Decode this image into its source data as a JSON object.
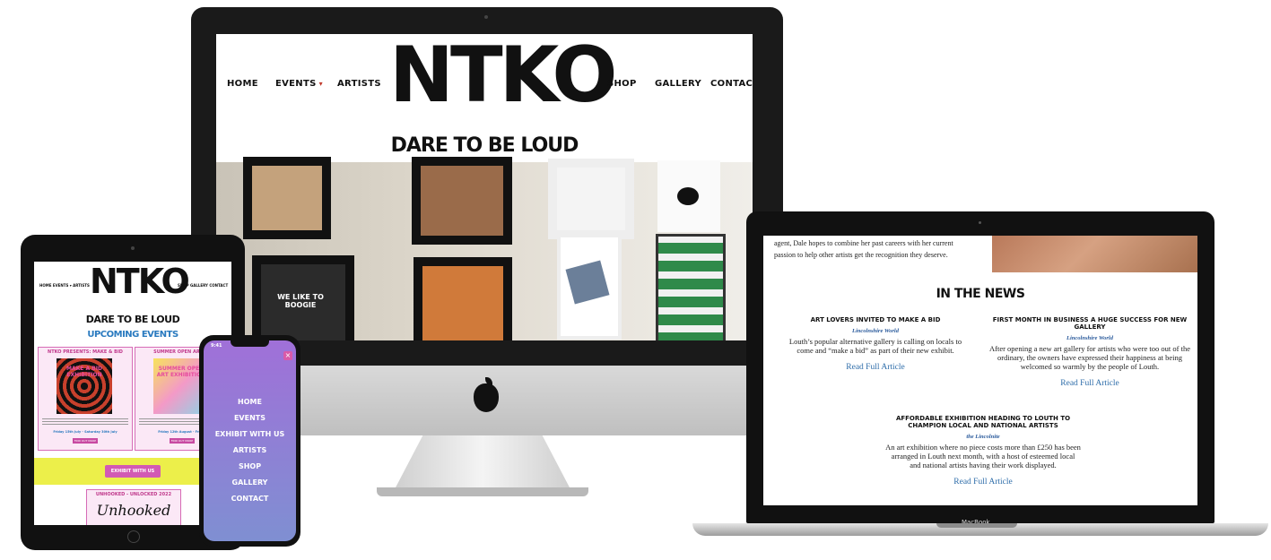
{
  "desktop": {
    "nav_left": [
      "HOME",
      "EVENTS",
      "ARTISTS"
    ],
    "dropdown_marker": "▾",
    "nav_right": [
      "SHOP",
      "GALLERY",
      "CONTACT"
    ],
    "logo": "NTKO",
    "slogan": "DARE TO BE LOUD",
    "apple_logo": "",
    "art_text": "WE LIKE TO BOOGIE"
  },
  "laptop": {
    "intro_line1": "agent, Dale hopes to combine her past careers with her current",
    "intro_line2": "passion to help other artists get the recognition they deserve.",
    "section_title": "IN THE NEWS",
    "articles": [
      {
        "title": "ART LOVERS INVITED TO MAKE A BID",
        "source": "Lincolnshire World",
        "body": "Louth’s popular alternative gallery is calling on locals to come and “make a bid” as part of their new exhibit.",
        "link": "Read Full Article"
      },
      {
        "title": "FIRST MONTH IN BUSINESS A HUGE SUCCESS FOR NEW GALLERY",
        "source": "Lincolnshire World",
        "body": "After opening a new art gallery for artists who were too out of the ordinary, the owners have expressed their happiness at being welcomed so warmly by the people of Louth.",
        "link": "Read Full Article"
      },
      {
        "title": "AFFORDABLE EXHIBITION HEADING TO LOUTH TO CHAMPION LOCAL AND NATIONAL ARTISTS",
        "source": "the Lincolnite",
        "body": "An art exhibition where no piece costs more than £250 has been arranged in Louth next month, with a host of esteemed local and national artists having their work displayed.",
        "link": "Read Full Article"
      }
    ],
    "brand": "MacBook"
  },
  "tablet": {
    "nav_left": "HOME  EVENTS ▾  ARTISTS",
    "nav_right": "SHOP  GALLERY  CONTACT",
    "logo": "NTKO",
    "slogan": "DARE TO BE LOUD",
    "section": "UPCOMING EVENTS",
    "cards": [
      {
        "title": "NTKO PRESENTS: MAKE & BID",
        "poster": "MAKE A BID EXHIBITION",
        "date": "Friday 15th July - Saturday 30th July",
        "button": "FIND OUT MORE"
      },
      {
        "title": "SUMMER OPEN ART EX",
        "poster": "SUMMER OPEN ART EXHIBITION",
        "date": "Friday 12th August - Friday",
        "button": "FIND OUT MORE"
      }
    ],
    "exhibit_button": "EXHIBIT WITH US",
    "unhooked_title": "UNHOOKED - UNLOCKED 2022",
    "unhooked_logo": "Unhooked",
    "colors": {
      "yellow_band": "#ecef4a",
      "pink": "#d25ab4"
    }
  },
  "phone": {
    "time": "9:41",
    "close": "×",
    "menu": [
      "HOME",
      "EVENTS",
      "EXHIBIT WITH US",
      "ARTISTS",
      "SHOP",
      "GALLERY",
      "CONTACT"
    ]
  }
}
